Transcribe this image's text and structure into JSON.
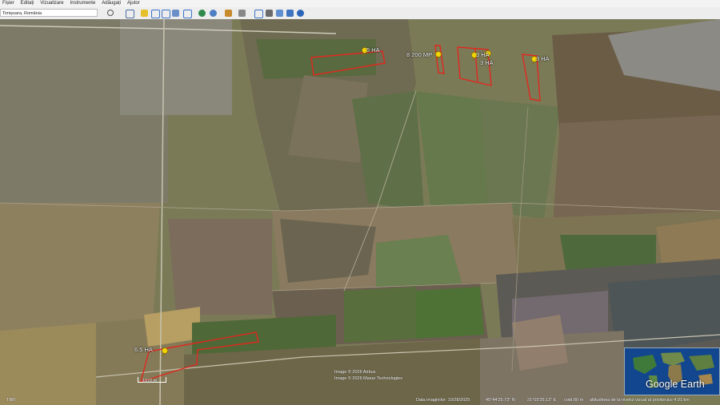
{
  "menu": [
    "Fișier",
    "Editați",
    "Vizualizare",
    "Instrumente",
    "Adăugați",
    "Ajutor"
  ],
  "search": {
    "value": "Timișoara, România"
  },
  "map": {
    "plots": [
      {
        "label": "5 HA"
      },
      {
        "label": "8 200 MP"
      },
      {
        "label": "3 HA"
      },
      {
        "label": "3 HA"
      },
      {
        "label": "3 HA"
      },
      {
        "label": "6.5 HA"
      }
    ],
    "scale_label": "1072 m",
    "imagery_credit_1": "Image © 2026 Airbus",
    "imagery_credit_2": "Image © 2026 Maxar Technologies",
    "plot_outline_color": "#e0281e",
    "pin_color": "#f2d600"
  },
  "status": {
    "left": "TIMI",
    "imagery_date": "Data imaginilor: 10/28/2025",
    "lat": "45°44'25.73\" N",
    "lon": "21°03'25.12\" E",
    "elev": "cotă 80 m",
    "eye_alt": "altitudinea de la nivelul vizual al privitorului 4.91 km"
  },
  "globe": {
    "brand": "Google Earth"
  }
}
